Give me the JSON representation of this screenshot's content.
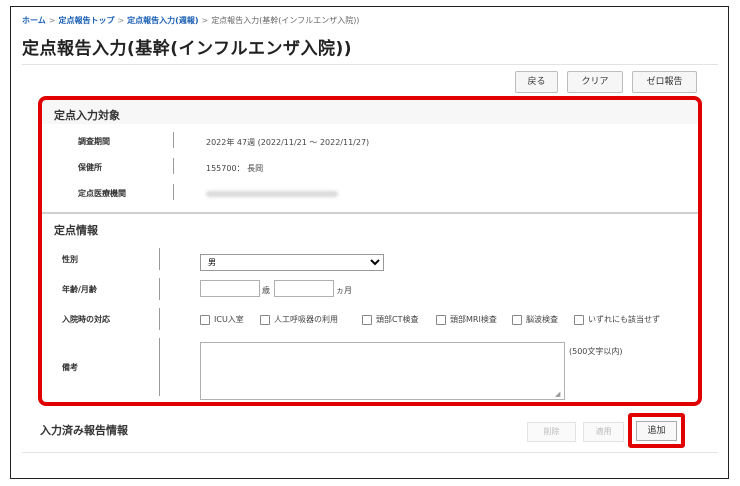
{
  "breadcrumb": {
    "items": [
      "ホーム",
      "定点報告トップ",
      "定点報告入力(週報)"
    ],
    "current": "定点報告入力(基幹(インフルエンザ入院))",
    "separator": ">"
  },
  "page": {
    "title": "定点報告入力(基幹(インフルエンザ入院))"
  },
  "toolbar": {
    "back_label": "戻る",
    "clear_label": "クリア",
    "zero_label": "ゼロ報告"
  },
  "target_section": {
    "heading": "定点入力対象",
    "rows": [
      {
        "label": "調査期間",
        "value": "2022年 47週 (2022/11/21 ～ 2022/11/27)"
      },
      {
        "label": "保健所",
        "value": "155700： 長岡"
      },
      {
        "label": "定点医療機関",
        "value": ""
      }
    ]
  },
  "info_section": {
    "heading": "定点情報",
    "sex_label": "性別",
    "sex_selected": "男",
    "age_label": "年齢/月齢",
    "age_unit_year": "歳",
    "age_unit_month": "ヵ月",
    "admission_label": "入院時の対応",
    "admission_options": [
      "ICU入室",
      "人工呼吸器の利用",
      "頭部CT検査",
      "頭部MRI検査",
      "脳波検査",
      "いずれにも該当せず"
    ],
    "memo_label": "備考",
    "memo_hint": "(500文字以内)"
  },
  "footer": {
    "title": "入力済み報告情報",
    "delete_label": "削除",
    "apply_label": "適用",
    "add_label": "追加"
  },
  "colors": {
    "highlight": "#e00000",
    "link": "#1a5fb4"
  }
}
